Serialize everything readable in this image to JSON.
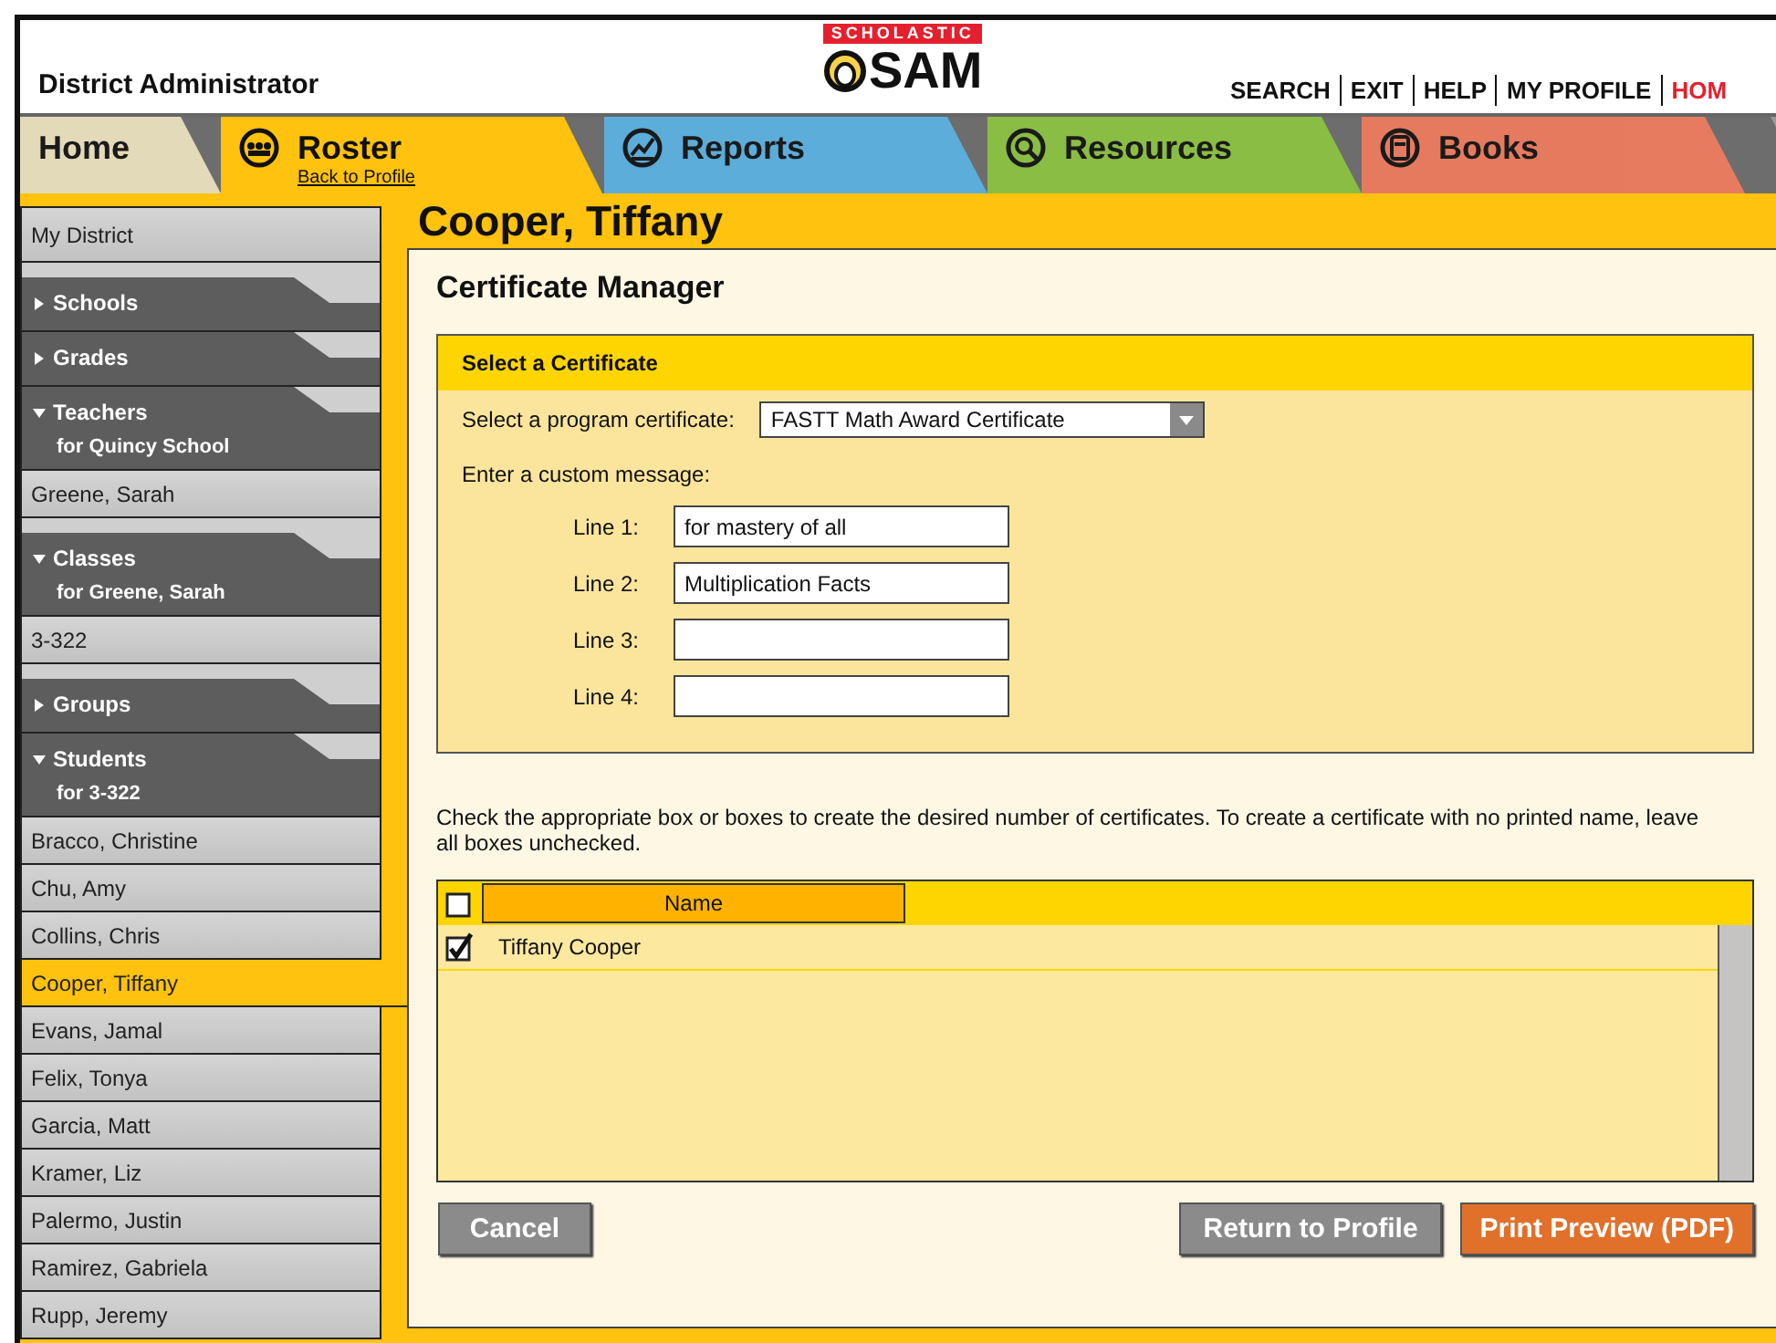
{
  "header": {
    "role": "District Administrator",
    "brand_tag": "SCHOLASTIC",
    "brand": "SAM",
    "links": [
      "SEARCH",
      "EXIT",
      "HELP",
      "MY PROFILE",
      "HOM"
    ]
  },
  "tabs": [
    {
      "label": "Home",
      "selected": false,
      "color": "#efe6c0"
    },
    {
      "label": "Roster",
      "selected": true,
      "color": "#ffc20e",
      "sublink": "Back to Profile"
    },
    {
      "label": "Reports",
      "selected": false,
      "color": "#5ab4e5"
    },
    {
      "label": "Resources",
      "selected": false,
      "color": "#8dc63f"
    },
    {
      "label": "Books",
      "selected": false,
      "color": "#f37c5e"
    }
  ],
  "sidebar": {
    "items": [
      {
        "kind": "link",
        "label": "My District",
        "selected": false
      },
      {
        "kind": "section",
        "label": "Schools",
        "expanded": false
      },
      {
        "kind": "section",
        "label": "Grades",
        "expanded": false
      },
      {
        "kind": "section",
        "label": "Teachers",
        "expanded": true,
        "subtitle": "for Quincy School"
      },
      {
        "kind": "link",
        "label": "Greene, Sarah",
        "selected": false
      },
      {
        "kind": "section",
        "label": "Classes",
        "expanded": true,
        "subtitle": "for Greene, Sarah"
      },
      {
        "kind": "link",
        "label": "3-322",
        "selected": false
      },
      {
        "kind": "section",
        "label": "Groups",
        "expanded": false
      },
      {
        "kind": "section",
        "label": "Students",
        "expanded": true,
        "subtitle": "for 3-322"
      },
      {
        "kind": "link",
        "label": "Bracco, Christine",
        "selected": false
      },
      {
        "kind": "link",
        "label": "Chu, Amy",
        "selected": false
      },
      {
        "kind": "link",
        "label": "Collins, Chris",
        "selected": false
      },
      {
        "kind": "link",
        "label": "Cooper, Tiffany",
        "selected": true
      },
      {
        "kind": "link",
        "label": "Evans, Jamal",
        "selected": false
      },
      {
        "kind": "link",
        "label": "Felix, Tonya",
        "selected": false
      },
      {
        "kind": "link",
        "label": "Garcia, Matt",
        "selected": false
      },
      {
        "kind": "link",
        "label": "Kramer, Liz",
        "selected": false
      },
      {
        "kind": "link",
        "label": "Palermo, Justin",
        "selected": false
      },
      {
        "kind": "link",
        "label": "Ramirez, Gabriela",
        "selected": false
      },
      {
        "kind": "link",
        "label": "Rupp, Jeremy",
        "selected": false
      }
    ]
  },
  "page_title": "Cooper, Tiffany",
  "panel": {
    "title": "Certificate Manager",
    "select_box": {
      "title": "Select a Certificate",
      "program_label": "Select a program certificate:",
      "program_value": "FASTT Math Award Certificate",
      "message_label": "Enter a custom message:",
      "lines": [
        {
          "label": "Line 1:",
          "value": "for mastery of all"
        },
        {
          "label": "Line 2:",
          "value": "Multiplication Facts"
        },
        {
          "label": "Line 3:"
        },
        {
          "label": "Line 4:"
        }
      ]
    },
    "instructions": "Check the appropriate box or boxes to create the desired number of certificates. To create a certificate with no printed name, leave all boxes unchecked.",
    "table": {
      "header_checked": false,
      "columns": [
        "Name"
      ],
      "rows": [
        {
          "name": "Tiffany Cooper",
          "checked": true
        }
      ]
    },
    "buttons": {
      "left": [
        "Cancel"
      ],
      "right": [
        {
          "label": "Return to Profile",
          "kind": "secondary"
        },
        {
          "label": "Print Preview (PDF)",
          "kind": "primary"
        }
      ]
    }
  }
}
